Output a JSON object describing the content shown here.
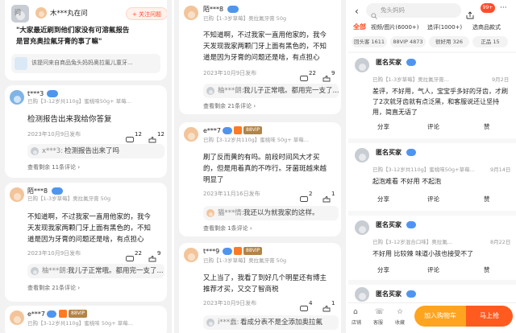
{
  "qa": {
    "asker": "木***丸在问",
    "follow_button": "+ 关注问题",
    "question_lines": [
      "\"大家最近刷到他们家没有可溶氟报告",
      "是冒充奥拉氟牙膏的事了嘛\""
    ],
    "product": "该提问来自商品兔头妈妈奥拉氟儿童牙..."
  },
  "answers_col1": [
    {
      "user": "t***3",
      "purchase": "已购【3-12岁共110g】蜜桃味50g+ 草莓...",
      "text": [
        "检测报告出来我给你答复"
      ],
      "date": "2023年10月9日发布",
      "likes": "12",
      "comments": "12",
      "reply_user": "x***3:",
      "reply_text": "检测报告出来了吗",
      "view_more": "查看剩余 11条评论 ›"
    },
    {
      "user": "陌***8",
      "purchase": "已购【1-3岁草莓】奥拉氟牙膏 50g",
      "text": [
        "不知道啊，不过我家一直用他家的，我今",
        "天发现我家两颗门牙上面有黑色的，不知",
        "道是因为牙膏的问题还是啥，有点担心"
      ],
      "date": "2023年10月9日发布",
      "likes": "22",
      "comments": "9",
      "reply_user": "柚***朗:",
      "reply_text": "我儿子正常哦。都用完一支了...",
      "view_more": "查看剩余 21条评论 ›"
    },
    {
      "user": "e***7",
      "vip": "88VIP",
      "purchase": "已购【3-12岁共110g】蜜桃味 50g+ 草莓..."
    }
  ],
  "answers_col2": [
    {
      "user": "陌***8",
      "purchase": "已购【1-3岁草莓】奥拉氟牙膏 50g",
      "text": [
        "不知道啊，不过我家一直用他家的，我今",
        "天发现我家两颗门牙上面有黑色的，不知",
        "道是因为牙膏的问题还是啥，有点担心"
      ],
      "date": "2023年10月9日发布",
      "likes": "22",
      "comments": "9",
      "reply_user": "柚***朗:",
      "reply_text": "我儿子正常哦。都用完一支了...",
      "view_more": "查看剩余 21条评论 ›"
    },
    {
      "user": "e***7",
      "vip": "88VIP",
      "purchase": "已购【3-12岁共110g】蜜桃味 50g+ 草莓...",
      "text": [
        "刷了反而黄的有吗。前段时间风大才买",
        "的，但是用着真的不咋行。牙菌斑越来越",
        "明显了"
      ],
      "date": "2023年11月16日发布",
      "likes": "2",
      "comments": "1",
      "reply_user": "猫***情:",
      "reply_text": "我还以为就我家的这样。",
      "view_more": "查看剩余 1条评论 ›"
    },
    {
      "user": "t***9",
      "vip": "88VIP",
      "purchase": "已购【1-3岁草莓】奥拉氟牙膏 50g",
      "text": [
        "又上当了，我看了到好几个明星还有博主",
        "推荐才买，又交了智商税"
      ],
      "date": "2023年10月9日发布",
      "likes": "4",
      "comments": "1",
      "reply_user": "i***蠢:",
      "reply_text": "看成分表不是全添加奥拉氟"
    }
  ],
  "shop": {
    "search_placeholder": "兔头妈妈",
    "cart_badge": "99+",
    "filters": [
      {
        "label": "全部",
        "active": true
      },
      {
        "label": "视频/图片(6000+)",
        "active": false
      },
      {
        "label": "追评(1000+)",
        "active": false
      },
      {
        "label": "选商品款式",
        "active": false
      }
    ],
    "tags": [
      "回头客 1611",
      "88VIP 4873",
      "很好用 326",
      "正品 15"
    ],
    "reviews": [
      {
        "user": "匿名买家",
        "purchase": "已购【1-3岁草莓】奥拉氟牙膏...",
        "date": "9月2日",
        "text": [
          "差评，不好用，气人，宝宝乎多好的牙齿，才刷",
          "了2次就牙齿就有点泛黑，和客服说还让坚持",
          "用，简直无语了"
        ]
      },
      {
        "user": "匿名买家",
        "purchase": "已购【3-12岁共110g】蜜桃味50g+草莓...",
        "date": "9月14日",
        "text": [
          "起泡难看 不好用 不起泡"
        ]
      },
      {
        "user": "匿名买家",
        "purchase": "已购【3-12岁混合口味】奥拉氟...",
        "date": "8月22日",
        "text": [
          "不好用 比较辣 味道小孩也接受不了"
        ]
      },
      {
        "user": "匿名买家"
      }
    ],
    "actions": {
      "share": "分享",
      "comment": "评论",
      "like": "赞"
    },
    "bottom_nav": [
      "店铺",
      "客服",
      "收藏"
    ],
    "add_cart": "加入购物车",
    "buy_now": "马上抢"
  },
  "colors": {
    "accent": "#ff4d2a",
    "badge": "#4f95f0",
    "vip": "#b28447",
    "cart_grad": "#ffb22c",
    "buy_grad": "#ff5a1f"
  }
}
